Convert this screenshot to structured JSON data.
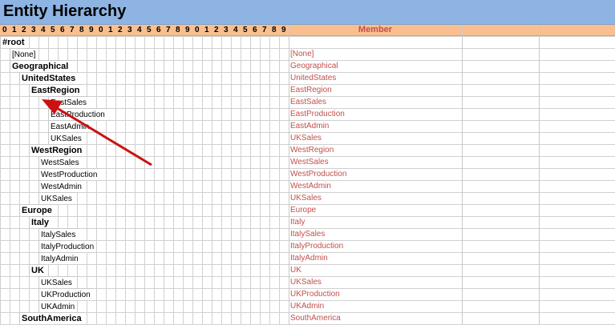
{
  "title": "Entity Hierarchy",
  "header": {
    "digits": [
      "0",
      "1",
      "2",
      "3",
      "4",
      "5",
      "6",
      "7",
      "8",
      "9",
      "0",
      "1",
      "2",
      "3",
      "4",
      "5",
      "6",
      "7",
      "8",
      "9",
      "0",
      "1",
      "2",
      "3",
      "4",
      "5",
      "6",
      "7",
      "8",
      "9"
    ],
    "member_label": "Member"
  },
  "rows": [
    {
      "name": "#root",
      "level": 0,
      "bold": true,
      "member": ""
    },
    {
      "name": "[None]",
      "level": 1,
      "bold": false,
      "member": "[None]"
    },
    {
      "name": "Geographical",
      "level": 1,
      "bold": true,
      "member": "Geographical"
    },
    {
      "name": "UnitedStates",
      "level": 2,
      "bold": true,
      "member": "UnitedStates"
    },
    {
      "name": "EastRegion",
      "level": 3,
      "bold": true,
      "member": "EastRegion"
    },
    {
      "name": "EastSales",
      "level": 5,
      "bold": false,
      "member": "EastSales"
    },
    {
      "name": "EastProduction",
      "level": 5,
      "bold": false,
      "member": "EastProduction"
    },
    {
      "name": "EastAdmin",
      "level": 5,
      "bold": false,
      "member": "EastAdmin"
    },
    {
      "name": "UKSales",
      "level": 5,
      "bold": false,
      "member": "UKSales"
    },
    {
      "name": "WestRegion",
      "level": 3,
      "bold": true,
      "member": "WestRegion"
    },
    {
      "name": "WestSales",
      "level": 4,
      "bold": false,
      "member": "WestSales"
    },
    {
      "name": "WestProduction",
      "level": 4,
      "bold": false,
      "member": "WestProduction"
    },
    {
      "name": "WestAdmin",
      "level": 4,
      "bold": false,
      "member": "WestAdmin"
    },
    {
      "name": "UKSales",
      "level": 4,
      "bold": false,
      "member": "UKSales"
    },
    {
      "name": "Europe",
      "level": 2,
      "bold": true,
      "member": "Europe"
    },
    {
      "name": "Italy",
      "level": 3,
      "bold": true,
      "member": "Italy"
    },
    {
      "name": "ItalySales",
      "level": 4,
      "bold": false,
      "member": "ItalySales"
    },
    {
      "name": "ItalyProduction",
      "level": 4,
      "bold": false,
      "member": "ItalyProduction"
    },
    {
      "name": "ItalyAdmin",
      "level": 4,
      "bold": false,
      "member": "ItalyAdmin"
    },
    {
      "name": "UK",
      "level": 3,
      "bold": true,
      "member": "UK"
    },
    {
      "name": "UKSales",
      "level": 4,
      "bold": false,
      "member": "UKSales"
    },
    {
      "name": "UKProduction",
      "level": 4,
      "bold": false,
      "member": "UKProduction"
    },
    {
      "name": "UKAdmin",
      "level": 4,
      "bold": false,
      "member": "UKAdmin"
    },
    {
      "name": "SouthAmerica",
      "level": 2,
      "bold": true,
      "member": "SouthAmerica"
    }
  ],
  "colors": {
    "title_bar": "#8db4e2",
    "header_row": "#fabf8f",
    "member_text": "#c0504d",
    "annotation_arrow": "#cc1111"
  },
  "annotation": {
    "type": "arrow",
    "color": "#cc1111"
  }
}
